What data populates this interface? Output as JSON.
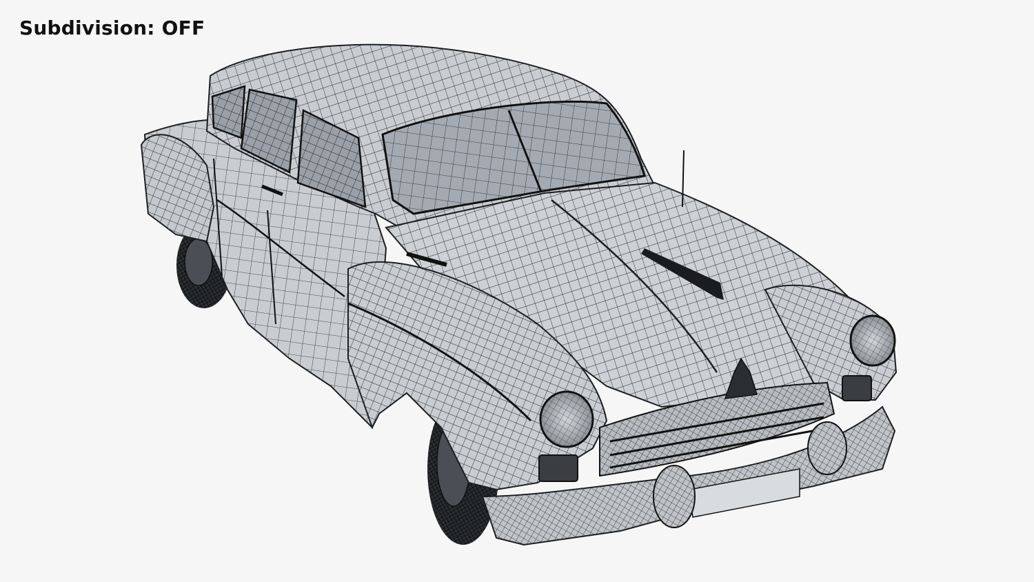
{
  "viewport": {
    "background_color": "#f6f6f6",
    "mesh_fill_color": "#c9cdd2",
    "mesh_dark_color": "#2a2d31",
    "wire_color": "#1c1e21"
  },
  "overlay": {
    "label": "Subdivision:",
    "value": "OFF"
  }
}
